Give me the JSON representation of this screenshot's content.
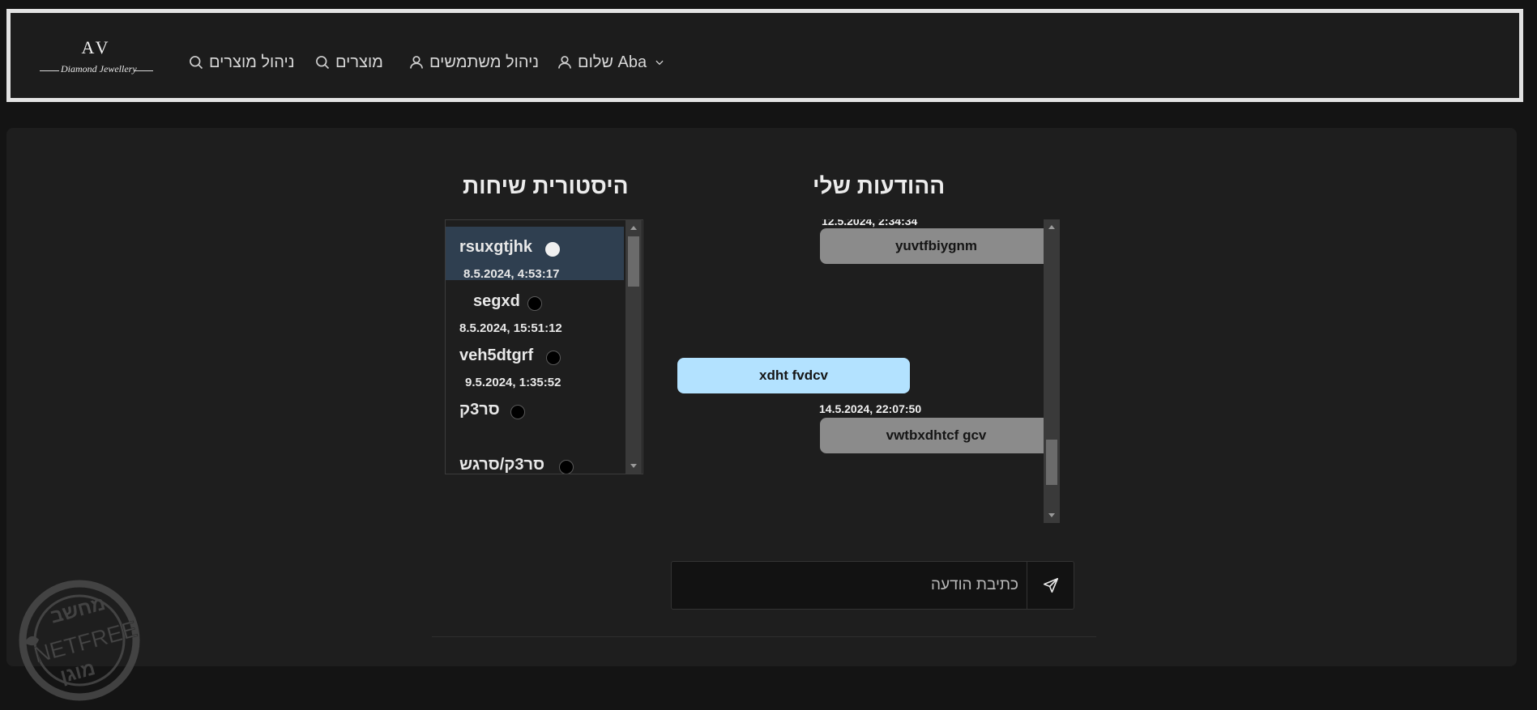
{
  "header": {
    "logo": {
      "letters": "AV",
      "script": "Diamond Jewellery"
    },
    "nav": [
      {
        "label": "ניהול מוצרים",
        "icon": "search-icon"
      },
      {
        "label": "מוצרים",
        "icon": "search-icon"
      },
      {
        "label": "ניהול משתמשים",
        "icon": "user-icon"
      },
      {
        "label": "שלום Aba",
        "icon": "user-icon",
        "dropdown": "chevron-down-icon"
      }
    ]
  },
  "chat": {
    "history_title": "היסטורית שיחות",
    "messages_title": "ההודעות שלי",
    "conversations": [
      {
        "name": "rsuxgtjhk",
        "date": "8.5.2024, 4:53:17",
        "online": true,
        "active": true
      },
      {
        "name": "segxd",
        "date": "8.5.2024, 15:51:12",
        "online": false,
        "active": false
      },
      {
        "name": "veh5dtgrf",
        "date": "9.5.2024, 1:35:52",
        "online": false,
        "active": false
      },
      {
        "name": "סר3ק",
        "date": "",
        "online": false,
        "active": false
      },
      {
        "name": "סר3ק/סרגש",
        "date": "",
        "online": false,
        "active": false
      }
    ],
    "messages": [
      {
        "text": "yuvtfbiygnm",
        "time": "12.5.2024, 2:34:34",
        "sender": "other"
      },
      {
        "text": "xdht fvdcv",
        "time": "",
        "sender": "me"
      },
      {
        "text": "vwtbxdhtcf gcv",
        "time": "14.5.2024, 22:07:50",
        "sender": "other"
      }
    ],
    "compose": {
      "placeholder": "כתיבת הודעה",
      "value": "",
      "send_icon": "send-icon"
    }
  },
  "watermark": {
    "top": "מחשב",
    "middle": "NETFREE",
    "bottom": "מוגן"
  },
  "colors": {
    "page_bg": "#141414",
    "panel_bg": "#1e1e1e",
    "active_conv": "#2f3f50",
    "my_bubble": "#b3e2ff",
    "other_bubble": "#8b8b8b",
    "header_border": "#e3e3e3"
  }
}
